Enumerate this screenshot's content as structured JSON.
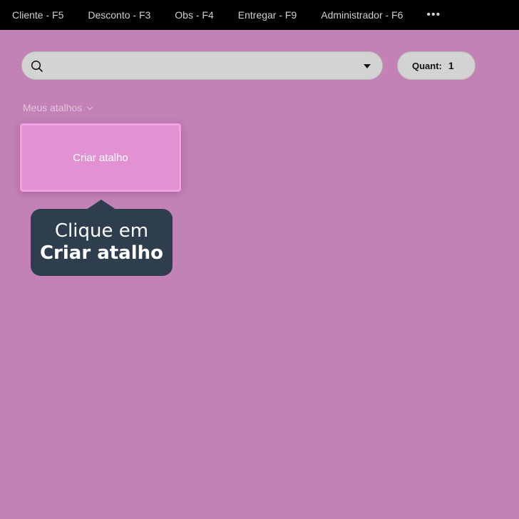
{
  "menu": {
    "items": [
      {
        "label": "Cliente - F5"
      },
      {
        "label": "Desconto - F3"
      },
      {
        "label": "Obs - F4"
      },
      {
        "label": "Entregar - F9"
      },
      {
        "label": "Administrador - F6"
      }
    ],
    "more_label": "•••"
  },
  "search": {
    "value": "",
    "icon": "search-icon"
  },
  "quantity": {
    "label": "Quant:",
    "value": "1"
  },
  "shortcuts": {
    "section_label": "Meus atalhos",
    "create_label": "Criar atalho"
  },
  "tooltip": {
    "line1": "Clique em",
    "line2": "Criar atalho"
  },
  "colors": {
    "background": "#c282b6",
    "topbar": "#000000",
    "tooltip_bg": "#2e3e4e",
    "create_button": "#e292d2"
  }
}
